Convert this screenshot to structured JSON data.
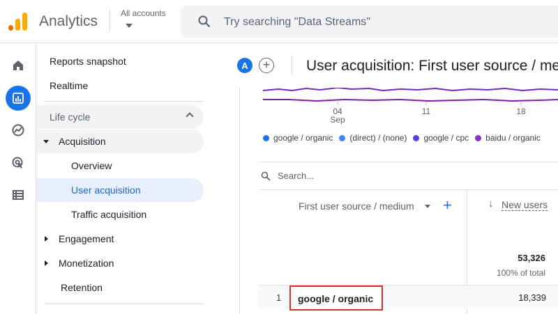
{
  "header": {
    "app_name": "Analytics",
    "account_label": "All accounts",
    "search_placeholder": "Try searching \"Data Streams\""
  },
  "rail": {
    "icons": [
      "home-icon",
      "reports-icon",
      "explore-icon",
      "advertising-icon",
      "configure-icon"
    ],
    "active": "reports-icon"
  },
  "nav": {
    "reports_snapshot": "Reports snapshot",
    "realtime": "Realtime",
    "lifecycle": "Life cycle",
    "acquisition": "Acquisition",
    "overview": "Overview",
    "user_acquisition": "User acquisition",
    "traffic_acquisition": "Traffic acquisition",
    "engagement": "Engagement",
    "monetization": "Monetization",
    "retention": "Retention"
  },
  "content": {
    "avatar_letter": "A",
    "page_title": "User acquisition: First user source / medium"
  },
  "chart_data": {
    "type": "line",
    "x_ticks": [
      {
        "label": "04",
        "sublabel": "Sep"
      },
      {
        "label": "11",
        "sublabel": ""
      },
      {
        "label": "18",
        "sublabel": ""
      }
    ],
    "series": [
      {
        "name": "google / organic",
        "color": "#1a73e8"
      },
      {
        "name": "(direct) / (none)",
        "color": "#4285f4"
      },
      {
        "name": "google / cpc",
        "color": "#5c3ee0"
      },
      {
        "name": "baidu / organic",
        "color": "#8430ce"
      }
    ]
  },
  "table": {
    "search_placeholder": "Search...",
    "dimension_header": "First user source / medium",
    "metric_header": "New users",
    "total_value": "53,326",
    "total_pct": "100% of total",
    "rows": [
      {
        "index": "1",
        "dimension": "google / organic",
        "value": "18,339"
      }
    ]
  }
}
